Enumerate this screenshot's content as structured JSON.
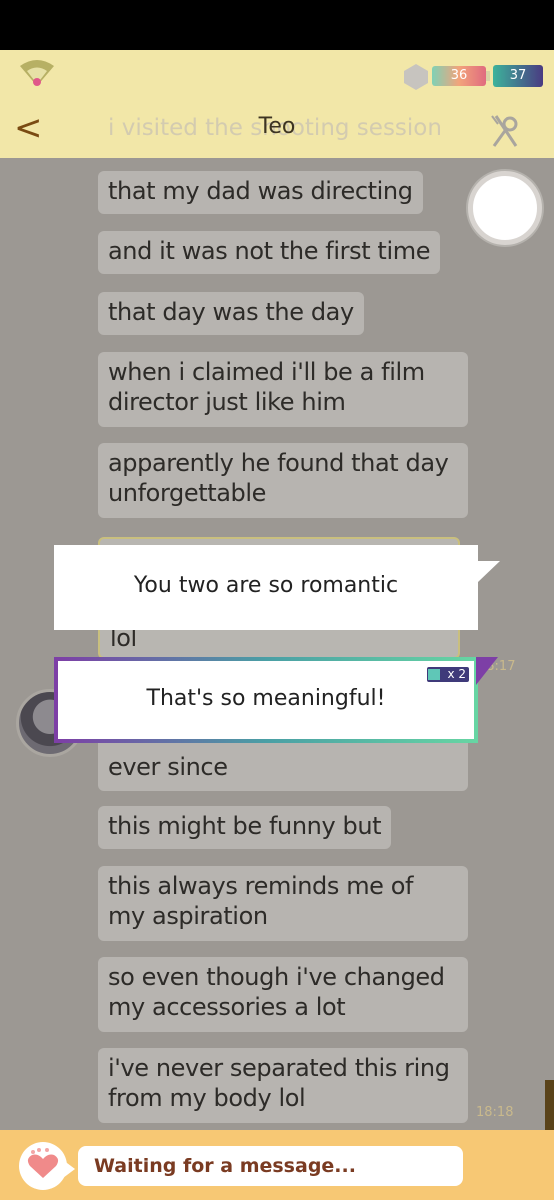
{
  "header": {
    "hp_value": "36",
    "gem_value": "37",
    "back_label": "<",
    "title": "Teo",
    "ghost_text": "i visited the shooting session"
  },
  "messages": [
    {
      "text": "that my dad was directing"
    },
    {
      "text": "and it was not the first time"
    },
    {
      "text": "that day was the day"
    },
    {
      "text": "when i claimed i'll be a film",
      "text2": "director just like him"
    },
    {
      "text": "apparently he found that day",
      "text2": "unforgettable"
    },
    {
      "text": "lol"
    },
    {
      "text": "ever since"
    },
    {
      "text": "this might be funny but"
    },
    {
      "text": "this always reminds me of",
      "text2": "my aspiration"
    },
    {
      "text": "so even though i've changed",
      "text2": "my accessories a lot"
    },
    {
      "text": "i've never separated this ring",
      "text2": "from my body lol"
    }
  ],
  "timestamps": [
    "18:17",
    "18:18"
  ],
  "replies": [
    {
      "text": "You two are so romantic"
    },
    {
      "text": "That's so meaningful!",
      "cost": "x 2"
    }
  ],
  "composer": {
    "placeholder": "Waiting for a message..."
  },
  "colors": {
    "header_bg": "#f2e7a8",
    "chat_bg": "#9c9893",
    "bubble_bg": "#b7b4b0",
    "footer_bg": "#f7c874",
    "accent_purple": "#7d3fa6",
    "accent_teal": "#67d5a3"
  }
}
